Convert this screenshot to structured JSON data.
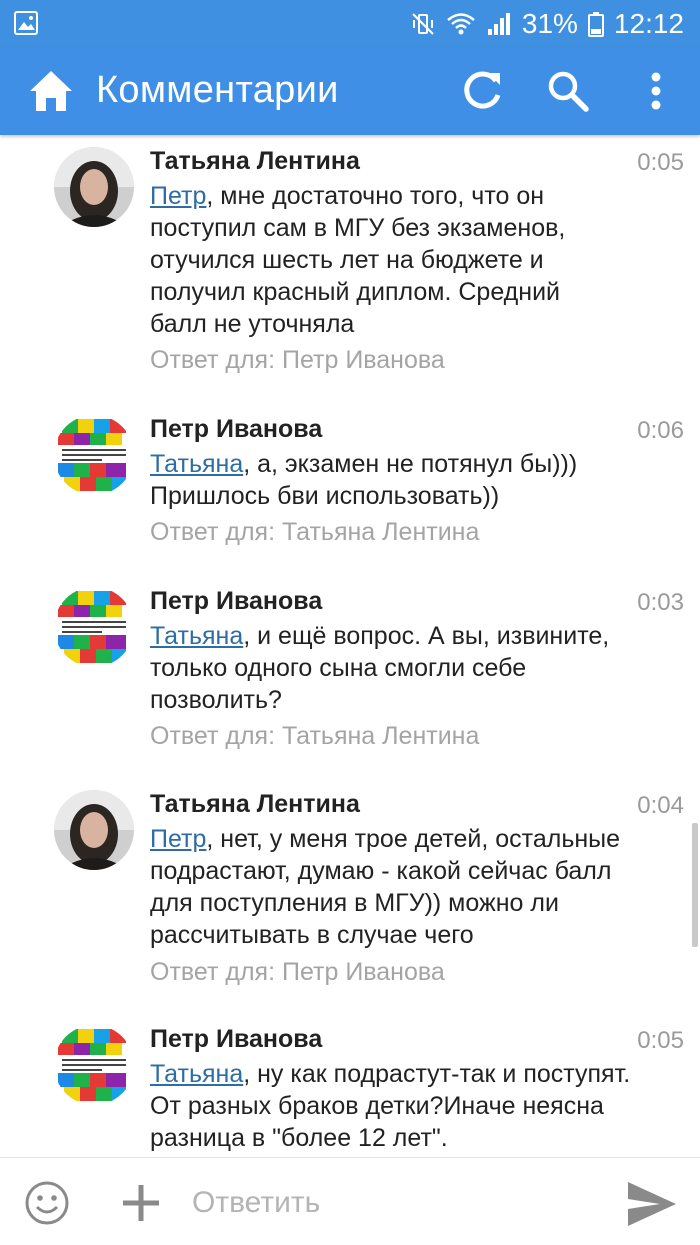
{
  "status_bar": {
    "battery": "31%",
    "time": "12:12",
    "icons": [
      "image-icon",
      "mute-vibrate-icon",
      "wifi-icon",
      "signal-icon",
      "battery-icon"
    ]
  },
  "app_bar": {
    "title": "Комментарии",
    "icons": [
      "home-icon",
      "refresh-icon",
      "search-icon",
      "more-vert-icon"
    ],
    "color": "#3f8fe6"
  },
  "comments": [
    {
      "author": "Татьяна Лентина",
      "time": "0:05",
      "mention": "Петр",
      "lines": [
        ", мне достаточно того, что он",
        "поступил сам в МГУ без экзаменов,",
        "отучился шесть лет на бюджете и",
        "получил красный диплом. Средний",
        "балл не уточняла"
      ],
      "reply_to": "Ответ для: Петр Иванова"
    },
    {
      "author": "Петр Иванова",
      "time": "0:06",
      "mention": "Татьяна",
      "lines": [
        ", а, экзамен не потянул бы)))",
        "Пришлось бви использовать))"
      ],
      "reply_to": "Ответ для: Татьяна Лентина"
    },
    {
      "author": "Петр Иванова",
      "time": "0:03",
      "mention": "Татьяна",
      "lines": [
        ", и ещё вопрос. А вы, извините,",
        "только одного сына смогли себе",
        "позволить?"
      ],
      "reply_to": "Ответ для: Татьяна Лентина"
    },
    {
      "author": "Татьяна Лентина",
      "time": "0:04",
      "mention": "Петр",
      "lines": [
        ", нет, у меня трое детей, остальные",
        "подрастают, думаю - какой сейчас балл",
        "для поступления в МГУ)) можно ли",
        "рассчитывать в случае чего"
      ],
      "reply_to": "Ответ для: Петр Иванова"
    },
    {
      "author": "Петр Иванова",
      "time": "0:05",
      "mention": "Татьяна",
      "lines": [
        ", ну как подрастут-так и поступят.",
        "От разных браков детки?Иначе неясна",
        "разница в \"более 12 лет\"."
      ],
      "reply_to": ""
    }
  ],
  "bottom_bar": {
    "placeholder": "Ответить",
    "icons": [
      "emoji-icon",
      "plus-icon",
      "send-icon"
    ]
  },
  "colors": {
    "accent": "#3f8fe6",
    "link": "#2d6da3",
    "meta": "#a4a4a4"
  }
}
